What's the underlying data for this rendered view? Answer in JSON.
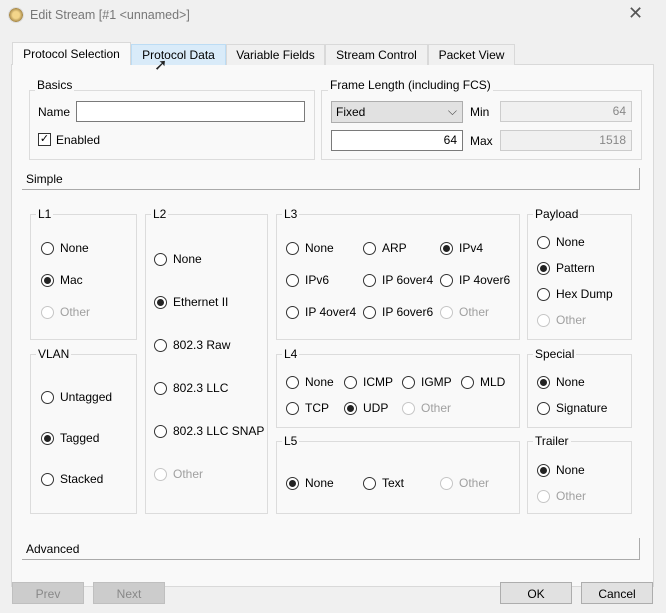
{
  "window": {
    "title": "Edit Stream [#1 <unnamed>]",
    "close": "✕"
  },
  "tabs": [
    {
      "label": "Protocol Selection",
      "state": "selected"
    },
    {
      "label": "Protocol Data",
      "state": "hover"
    },
    {
      "label": "Variable Fields"
    },
    {
      "label": "Stream Control"
    },
    {
      "label": "Packet View"
    }
  ],
  "basics": {
    "title": "Basics",
    "name_label": "Name",
    "name_value": "",
    "enabled_label": "Enabled",
    "enabled": true,
    "check": "✓"
  },
  "frame_length": {
    "title": "Frame Length (including FCS)",
    "mode": "Fixed",
    "length": "64",
    "min_label": "Min",
    "min": "64",
    "max_label": "Max",
    "max": "1518"
  },
  "simple_label": "Simple",
  "advanced_label": "Advanced",
  "groups": {
    "l1": {
      "title": "L1",
      "options": [
        {
          "label": "None"
        },
        {
          "label": "Mac",
          "checked": true
        },
        {
          "label": "Other",
          "disabled": true
        }
      ]
    },
    "vlan": {
      "title": "VLAN",
      "options": [
        {
          "label": "Untagged"
        },
        {
          "label": "Tagged",
          "checked": true
        },
        {
          "label": "Stacked"
        }
      ]
    },
    "l2": {
      "title": "L2",
      "options": [
        {
          "label": "None"
        },
        {
          "label": "Ethernet II",
          "checked": true
        },
        {
          "label": "802.3 Raw"
        },
        {
          "label": "802.3 LLC"
        },
        {
          "label": "802.3 LLC SNAP"
        },
        {
          "label": "Other",
          "disabled": true
        }
      ]
    },
    "l3": {
      "title": "L3",
      "options": [
        {
          "label": "None"
        },
        {
          "label": "ARP"
        },
        {
          "label": "IPv4",
          "checked": true
        },
        {
          "label": "IPv6"
        },
        {
          "label": "IP 6over4"
        },
        {
          "label": "IP 4over6"
        },
        {
          "label": "IP 4over4"
        },
        {
          "label": "IP 6over6"
        },
        {
          "label": "Other",
          "disabled": true
        }
      ]
    },
    "l4": {
      "title": "L4",
      "options": [
        {
          "label": "None"
        },
        {
          "label": "ICMP"
        },
        {
          "label": "IGMP"
        },
        {
          "label": "MLD"
        },
        {
          "label": "TCP"
        },
        {
          "label": "UDP",
          "checked": true
        },
        {
          "label": "Other",
          "disabled": true
        }
      ]
    },
    "l5": {
      "title": "L5",
      "options": [
        {
          "label": "None",
          "checked": true
        },
        {
          "label": "Text"
        },
        {
          "label": "Other",
          "disabled": true
        }
      ]
    },
    "payload": {
      "title": "Payload",
      "options": [
        {
          "label": "None"
        },
        {
          "label": "Pattern",
          "checked": true
        },
        {
          "label": "Hex Dump"
        },
        {
          "label": "Other",
          "disabled": true
        }
      ]
    },
    "special": {
      "title": "Special",
      "options": [
        {
          "label": "None",
          "checked": true
        },
        {
          "label": "Signature"
        }
      ]
    },
    "trailer": {
      "title": "Trailer",
      "options": [
        {
          "label": "None",
          "checked": true
        },
        {
          "label": "Other",
          "disabled": true
        }
      ]
    }
  },
  "buttons": {
    "prev": "Prev",
    "next": "Next",
    "ok": "OK",
    "cancel": "Cancel"
  }
}
